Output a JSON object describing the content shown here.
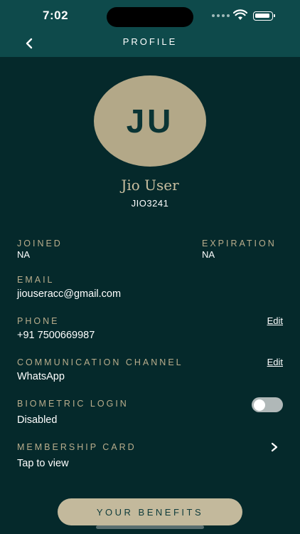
{
  "status_bar": {
    "time": "7:02"
  },
  "nav": {
    "title": "PROFILE"
  },
  "profile": {
    "initials": "JU",
    "name": "Jio User",
    "user_id": "JIO3241"
  },
  "fields": {
    "joined": {
      "label": "JOINED",
      "value": "NA"
    },
    "expiration": {
      "label": "EXPIRATION",
      "value": "NA"
    },
    "email": {
      "label": "EMAIL",
      "value": "jiouseracc@gmail.com"
    },
    "phone": {
      "label": "PHONE",
      "value": "+91 7500669987",
      "action": "Edit"
    },
    "communication_channel": {
      "label": "COMMUNICATION CHANNEL",
      "value": "WhatsApp",
      "action": "Edit"
    },
    "biometric_login": {
      "label": "BIOMETRIC LOGIN",
      "value": "Disabled",
      "enabled": false
    },
    "membership_card": {
      "label": "MEMBERSHIP CARD",
      "value": "Tap to view"
    }
  },
  "footer": {
    "benefits_button": "YOUR BENEFITS"
  },
  "colors": {
    "background": "#05292b",
    "header": "#0e4a4b",
    "accent_gold": "#b9ad8c",
    "avatar_bg": "#b3a888",
    "button_bg": "#c3b99c"
  },
  "icons": [
    "back-chevron-icon",
    "wifi-icon",
    "battery-icon",
    "chevron-right-icon"
  ]
}
